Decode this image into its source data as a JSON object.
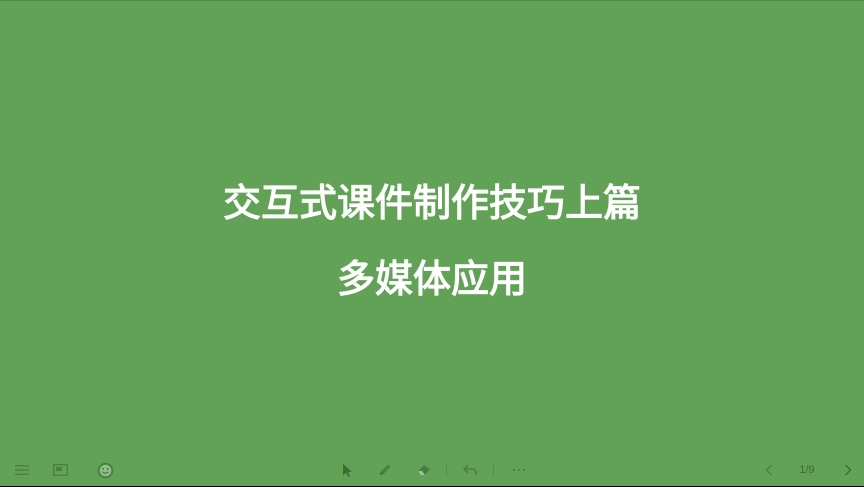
{
  "slide": {
    "title": "交互式课件制作技巧上篇",
    "subtitle": "多媒体应用",
    "background_color": "#62a257"
  },
  "toolbar": {
    "page_indicator": "1/9",
    "more_label": "···",
    "icons": [
      "menu-icon",
      "slide-overview-icon",
      "smiley-icon",
      "pointer-arrow-icon",
      "pen-icon",
      "eraser-icon",
      "undo-icon",
      "more-icon",
      "previous-page-icon",
      "next-page-icon"
    ]
  }
}
